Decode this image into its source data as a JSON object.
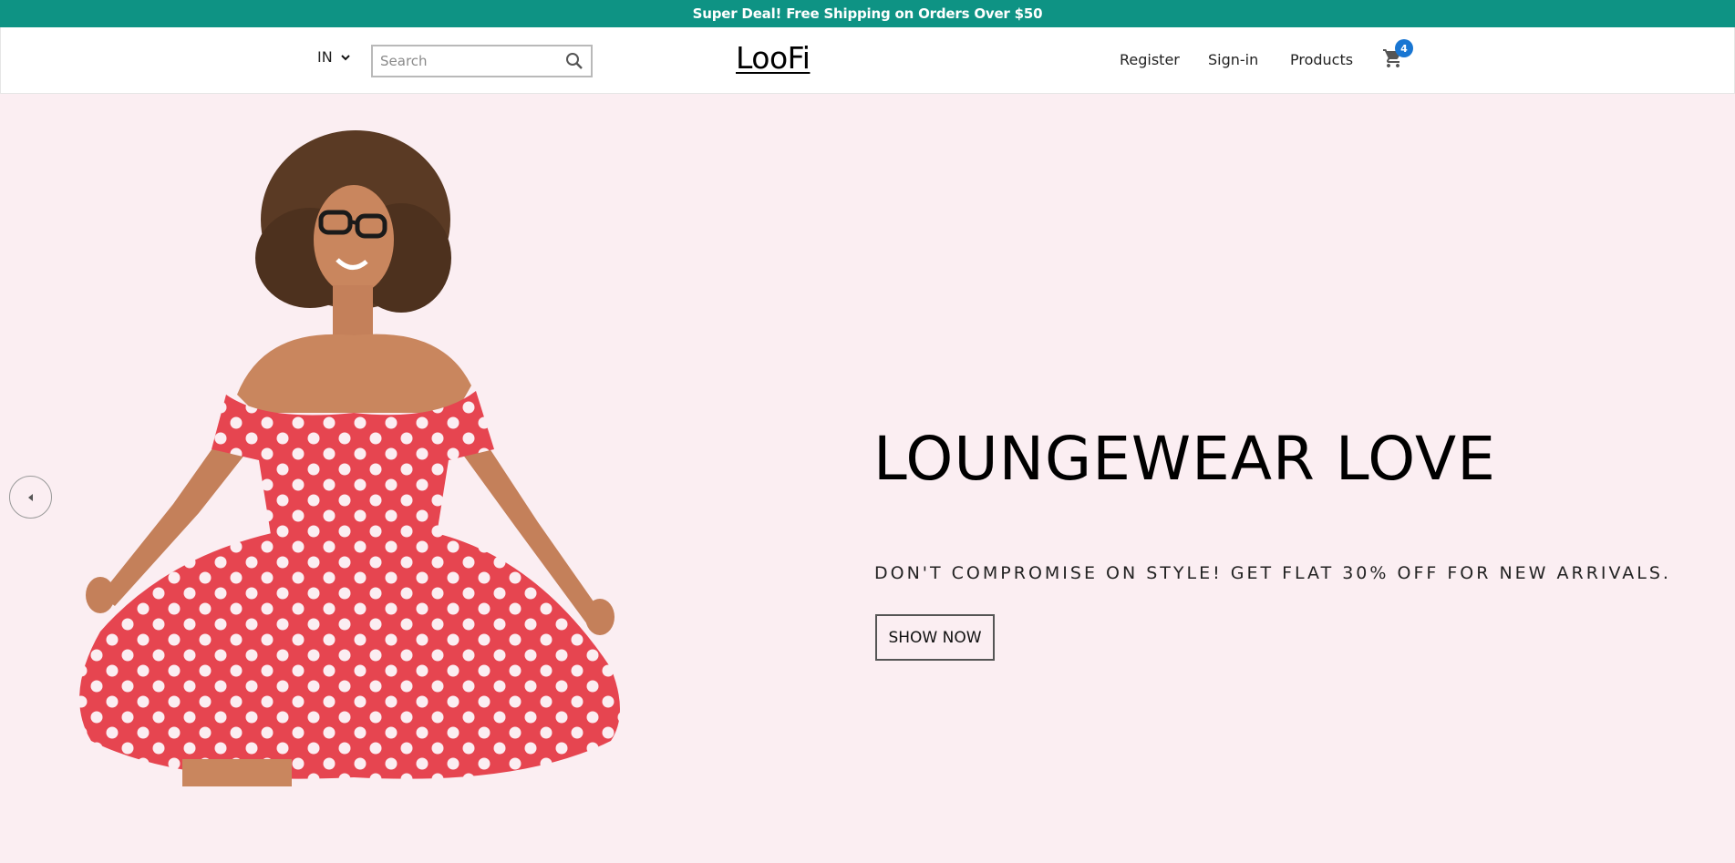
{
  "announcement": {
    "text": "Super Deal! Free Shipping on Orders Over $50"
  },
  "header": {
    "language": "IN",
    "search": {
      "placeholder": "Search",
      "value": ""
    },
    "logo": "LooFi",
    "nav": {
      "register": "Register",
      "signin": "Sign-in",
      "products": "Products"
    },
    "cart": {
      "count": "4"
    }
  },
  "hero": {
    "title": "LOUNGEWEAR LOVE",
    "subtitle": "DON'T COMPROMISE ON STYLE! GET FLAT 30% OFF FOR NEW ARRIVALS.",
    "cta": "SHOW NOW"
  },
  "colors": {
    "announcement_bg": "#0e9384",
    "hero_bg": "#fbeef2",
    "badge": "#1976d2",
    "dress": "#e64550"
  },
  "icons": {
    "language_dropdown": "chevron-down-icon",
    "search": "search-icon",
    "cart": "cart-icon",
    "prev": "chevron-left-icon"
  }
}
